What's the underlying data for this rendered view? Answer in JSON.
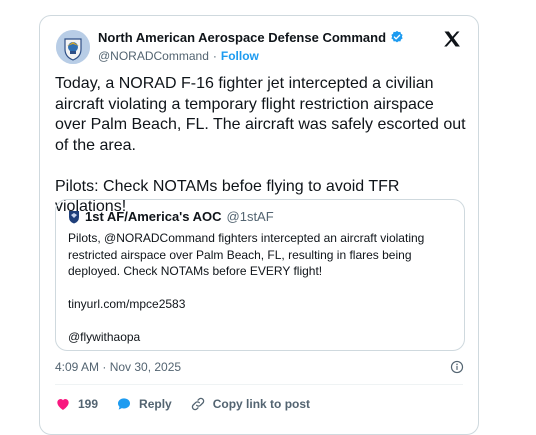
{
  "author": {
    "name": "North American Aerospace Defense Command",
    "handle": "@NORADCommand",
    "separator": "·",
    "follow_label": "Follow"
  },
  "post": {
    "text": "Today, a NORAD F-16 fighter jet intercepted a civilian aircraft violating a temporary flight restriction airspace over Palm Beach, FL. The aircraft was safely escorted out of the area.\n\nPilots: Check NOTAMs befoe flying to avoid TFR violations!"
  },
  "quote": {
    "name": "1st AF/America's AOC",
    "handle": "@1stAF",
    "text": "Pilots, @NORADCommand fighters intercepted an aircraft violating restricted airspace over Palm Beach, FL, resulting in flares being deployed. Check NOTAMs before EVERY flight!\n\ntinyurl.com/mpce2583\n\n@flywithaopa"
  },
  "meta": {
    "timestamp": "4:09 AM · Nov 30, 2025"
  },
  "actions": {
    "like_count": "199",
    "reply_label": "Reply",
    "copy_label": "Copy link to post"
  },
  "colors": {
    "accent": "#1d9bf0",
    "like": "#f91880",
    "muted": "#536471",
    "border": "#cfd9de"
  },
  "icons": [
    "norad-logo-icon",
    "verified-badge-icon",
    "x-logo-icon",
    "info-icon",
    "heart-icon",
    "reply-bubble-icon",
    "link-icon"
  ]
}
